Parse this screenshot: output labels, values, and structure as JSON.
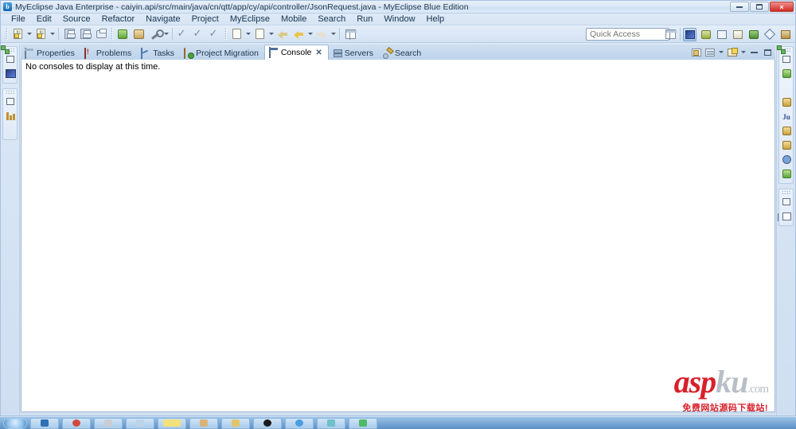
{
  "window": {
    "title": "MyEclipse Java Enterprise - caiyin.api/src/main/java/cn/qtt/app/cy/api/controller/JsonRequest.java - MyEclipse Blue Edition",
    "app_icon": "b",
    "controls": {
      "minimize": "minimize-icon",
      "maximize": "maximize-icon",
      "close": "×"
    }
  },
  "menubar": {
    "items": [
      {
        "label": "File"
      },
      {
        "label": "Edit"
      },
      {
        "label": "Source"
      },
      {
        "label": "Refactor"
      },
      {
        "label": "Navigate"
      },
      {
        "label": "Project"
      },
      {
        "label": "MyEclipse"
      },
      {
        "label": "Mobile"
      },
      {
        "label": "Search"
      },
      {
        "label": "Run"
      },
      {
        "label": "Window"
      },
      {
        "label": "Help"
      }
    ]
  },
  "toolbar": {
    "quick_access_placeholder": "Quick Access",
    "quick_access_value": "",
    "buttons": [
      {
        "name": "new-wizard",
        "icon": "new-document-icon"
      },
      {
        "name": "new-java-project",
        "icon": "new-project-icon"
      },
      {
        "name": "save",
        "icon": "save-icon"
      },
      {
        "name": "save-all",
        "icon": "save-all-icon"
      },
      {
        "name": "print",
        "icon": "print-icon"
      },
      {
        "name": "run-last",
        "icon": "run-icon"
      },
      {
        "name": "deploy",
        "icon": "deploy-icon"
      },
      {
        "name": "external-tools",
        "icon": "wrench-icon"
      },
      {
        "name": "toggle-mark-occurrences",
        "icon": "check-icon"
      },
      {
        "name": "skip-breakpoints",
        "icon": "skip-breakpoints-icon"
      },
      {
        "name": "debug-last",
        "icon": "debug-icon"
      },
      {
        "name": "new-class",
        "icon": "new-class-icon"
      },
      {
        "name": "open-type",
        "icon": "open-type-icon"
      },
      {
        "name": "previous-annotation",
        "icon": "previous-annotation-icon"
      },
      {
        "name": "back",
        "icon": "back-arrow-icon"
      },
      {
        "name": "forward",
        "icon": "forward-arrow-icon"
      },
      {
        "name": "pin-editor",
        "icon": "pin-editor-icon"
      }
    ],
    "perspective_buttons": [
      {
        "name": "open-perspective",
        "icon": "open-perspective-icon"
      },
      {
        "name": "perspective-myeclipse-java-enterprise",
        "icon": "java-enterprise-perspective-icon",
        "active": true
      },
      {
        "name": "perspective-debug",
        "icon": "debug-perspective-icon"
      },
      {
        "name": "perspective-team-sync",
        "icon": "team-sync-perspective-icon"
      },
      {
        "name": "perspective-resource",
        "icon": "resource-perspective-icon"
      },
      {
        "name": "perspective-database",
        "icon": "database-perspective-icon"
      },
      {
        "name": "perspective-other",
        "icon": "diamond-perspective-icon"
      },
      {
        "name": "perspective-report",
        "icon": "report-perspective-icon"
      }
    ]
  },
  "left_fastview": {
    "groups": [
      {
        "items": [
          {
            "name": "restore-view",
            "icon": "restore-icon"
          },
          {
            "name": "fastview-package-explorer",
            "icon": "package-explorer-icon"
          }
        ]
      },
      {
        "items": [
          {
            "name": "restore-view-2",
            "icon": "restore-icon"
          },
          {
            "name": "fastview-outline",
            "icon": "outline-icon"
          },
          {
            "name": "fastview-hierarchy",
            "icon": "hierarchy-icon"
          }
        ]
      }
    ]
  },
  "right_fastview": {
    "groups": [
      {
        "items": [
          {
            "name": "restore-view",
            "icon": "restore-icon"
          },
          {
            "name": "fastview-servers",
            "icon": "servers-icon"
          },
          {
            "name": "fastview-snippets",
            "icon": "snippets-icon"
          },
          {
            "name": "fastview-search",
            "icon": "search-icon"
          },
          {
            "name": "fastview-junit",
            "icon": "junit-icon"
          },
          {
            "name": "fastview-db-browser",
            "icon": "database-icon"
          },
          {
            "name": "fastview-db-explorer",
            "icon": "db-explorer-icon"
          },
          {
            "name": "fastview-debug",
            "icon": "debug-icon"
          },
          {
            "name": "fastview-install",
            "icon": "install-icon"
          }
        ]
      },
      {
        "items": [
          {
            "name": "restore-view-2",
            "icon": "restore-icon"
          },
          {
            "name": "fastview-layout",
            "icon": "layout-icon"
          }
        ]
      }
    ]
  },
  "view_stack": {
    "tabs": [
      {
        "label": "Properties",
        "icon": "properties-icon",
        "active": false,
        "closable": false
      },
      {
        "label": "Problems",
        "icon": "problems-icon",
        "active": false,
        "closable": false
      },
      {
        "label": "Tasks",
        "icon": "tasks-icon",
        "active": false,
        "closable": false
      },
      {
        "label": "Project Migration",
        "icon": "project-migration-icon",
        "active": false,
        "closable": false
      },
      {
        "label": "Console",
        "icon": "console-icon",
        "active": true,
        "closable": true,
        "close_label": "✕"
      },
      {
        "label": "Servers",
        "icon": "servers-icon",
        "active": false,
        "closable": false
      },
      {
        "label": "Search",
        "icon": "search-icon",
        "active": false,
        "closable": false
      }
    ],
    "view_tools": [
      {
        "name": "open-console",
        "icon": "open-console-icon"
      },
      {
        "name": "display-selected-console",
        "icon": "display-console-icon"
      },
      {
        "name": "new-console-view",
        "icon": "new-console-view-icon"
      },
      {
        "name": "view-menu",
        "icon": "chevron-down-icon"
      },
      {
        "name": "minimize-view",
        "icon": "minimize-icon"
      },
      {
        "name": "maximize-view",
        "icon": "maximize-icon"
      }
    ],
    "console": {
      "message": "No consoles to display at this time."
    }
  },
  "watermark": {
    "part1": "asp",
    "part2": "ku",
    "part3": ".com",
    "subtitle": "免费网站源码下载站!"
  },
  "taskbar": {
    "start_label": "",
    "items": [
      {
        "name": "taskbar-explorer",
        "color": "#2f6fb5"
      },
      {
        "name": "taskbar-browser",
        "color": "#d04a3f"
      },
      {
        "name": "taskbar-app-3",
        "color": "#c9cdd2"
      },
      {
        "name": "taskbar-app-4",
        "color": "#bcd3e8"
      },
      {
        "name": "taskbar-notepad",
        "color": "#f2e07a"
      },
      {
        "name": "taskbar-app-6",
        "color": "#d8b37a"
      },
      {
        "name": "taskbar-app-7",
        "color": "#e2c56a"
      },
      {
        "name": "taskbar-app-8",
        "color": "#1b1b1b"
      },
      {
        "name": "taskbar-app-9",
        "color": "#4a9de0"
      },
      {
        "name": "taskbar-app-10",
        "color": "#6fc0c8"
      },
      {
        "name": "taskbar-app-11",
        "color": "#4fba67"
      }
    ]
  },
  "colors": {
    "accent": "#4a79ab",
    "close_button": "#cf2b22",
    "watermark_red": "#d8202a",
    "console_bg": "#ffffff"
  }
}
